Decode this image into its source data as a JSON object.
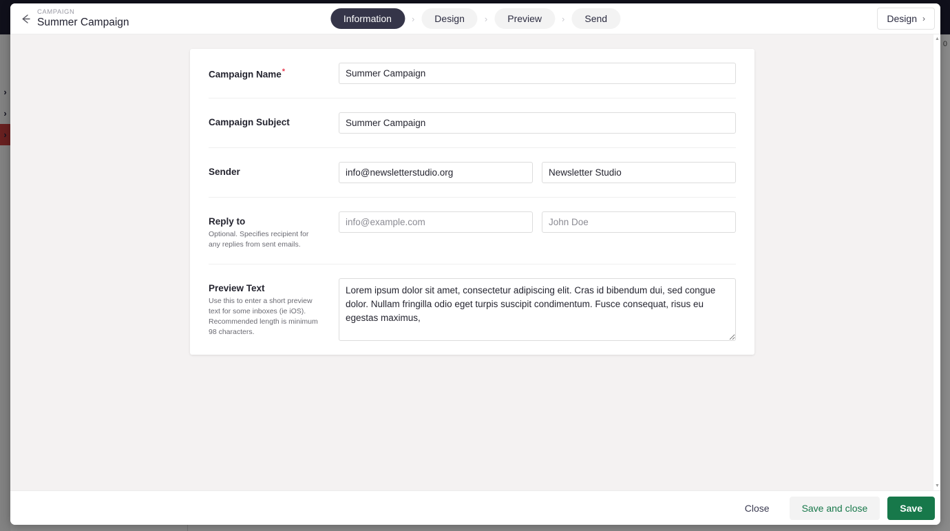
{
  "background": {
    "sidebar_items": [
      {
        "icon": "chevron-right-icon",
        "selected": false
      },
      {
        "icon": "chevron-right-icon",
        "selected": false
      },
      {
        "icon": "chevron-right-icon",
        "selected": true
      }
    ],
    "right_edge_value": "0"
  },
  "header": {
    "back_icon": "arrow-left-icon",
    "eyebrow": "CAMPAIGN",
    "title": "Summer Campaign",
    "right_button_label": "Design",
    "right_button_icon": "chevron-right-icon"
  },
  "steps": {
    "separator": "›",
    "tabs": [
      {
        "label": "Information",
        "active": true
      },
      {
        "label": "Design",
        "active": false
      },
      {
        "label": "Preview",
        "active": false
      },
      {
        "label": "Send",
        "active": false
      }
    ]
  },
  "form": {
    "campaign_name": {
      "label": "Campaign Name",
      "required_marker": "*",
      "value": "Summer Campaign",
      "placeholder": ""
    },
    "campaign_subject": {
      "label": "Campaign Subject",
      "value": "Summer Campaign",
      "placeholder": ""
    },
    "sender": {
      "label": "Sender",
      "email_value": "info@newsletterstudio.org",
      "email_placeholder": "info@example.com",
      "name_value": "Newsletter Studio",
      "name_placeholder": "John Doe"
    },
    "reply_to": {
      "label": "Reply to",
      "help": "Optional. Specifies recipient for any replies from sent emails.",
      "email_value": "",
      "email_placeholder": "info@example.com",
      "name_value": "",
      "name_placeholder": "John Doe"
    },
    "preview_text": {
      "label": "Preview Text",
      "help": "Use this to enter a short preview text for some inboxes (ie iOS). Recommended length is minimum 98 characters.",
      "value": "Lorem ipsum dolor sit amet, consectetur adipiscing elit. Cras id bibendum dui, sed congue dolor. Nullam fringilla odio eget turpis suscipit condimentum. Fusce consequat, risus eu egestas maximus,",
      "placeholder": ""
    }
  },
  "scrollbar": {
    "up_arrow": "▲",
    "down_arrow": "▼"
  },
  "footer": {
    "close_label": "Close",
    "save_and_close_label": "Save and close",
    "save_label": "Save"
  },
  "colors": {
    "primary_green": "#17784a",
    "active_tab": "#353549",
    "required_red": "#e8394f",
    "topbar_navy": "#1e1e32",
    "sidebar_selected": "#c13b3b"
  }
}
